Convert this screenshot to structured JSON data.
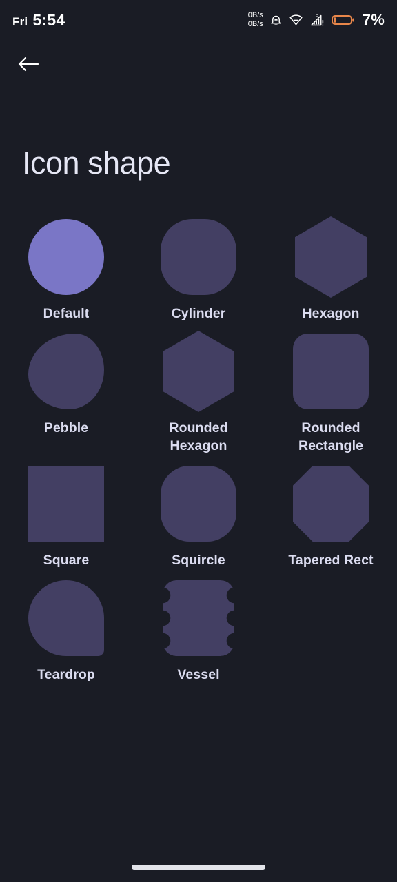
{
  "status_bar": {
    "day": "Fri",
    "time": "5:54",
    "net_speed_up": "0B/s",
    "net_speed_down": "0B/s",
    "battery_percent": "7%",
    "roaming_label": "R",
    "icons": [
      "alarm-off-icon",
      "wifi-icon",
      "signal-roaming-icon",
      "battery-icon"
    ],
    "battery_color": "#e8864a"
  },
  "nav": {
    "back_label": "Back"
  },
  "header": {
    "title": "Icon shape"
  },
  "theme": {
    "background": "#1a1c25",
    "shape_color": "#433f63",
    "selected_shape_color": "#7a76c6",
    "label_color": "#dbdcf0",
    "title_color": "#e6e7f5"
  },
  "shapes": [
    {
      "label": "Default",
      "shape": "circle",
      "selected": true
    },
    {
      "label": "Cylinder",
      "shape": "cylinder",
      "selected": false
    },
    {
      "label": "Hexagon",
      "shape": "hexagon",
      "selected": false
    },
    {
      "label": "Pebble",
      "shape": "pebble",
      "selected": false
    },
    {
      "label": "Rounded Hexagon",
      "shape": "rounded-hexagon",
      "selected": false
    },
    {
      "label": "Rounded Rectangle",
      "shape": "rounded-rectangle",
      "selected": false
    },
    {
      "label": "Square",
      "shape": "square",
      "selected": false
    },
    {
      "label": "Squircle",
      "shape": "squircle",
      "selected": false
    },
    {
      "label": "Tapered Rect",
      "shape": "tapered-rect",
      "selected": false
    },
    {
      "label": "Teardrop",
      "shape": "teardrop",
      "selected": false
    },
    {
      "label": "Vessel",
      "shape": "vessel",
      "selected": false
    }
  ],
  "system_nav": {
    "home_pill": "home-gesture-pill"
  }
}
